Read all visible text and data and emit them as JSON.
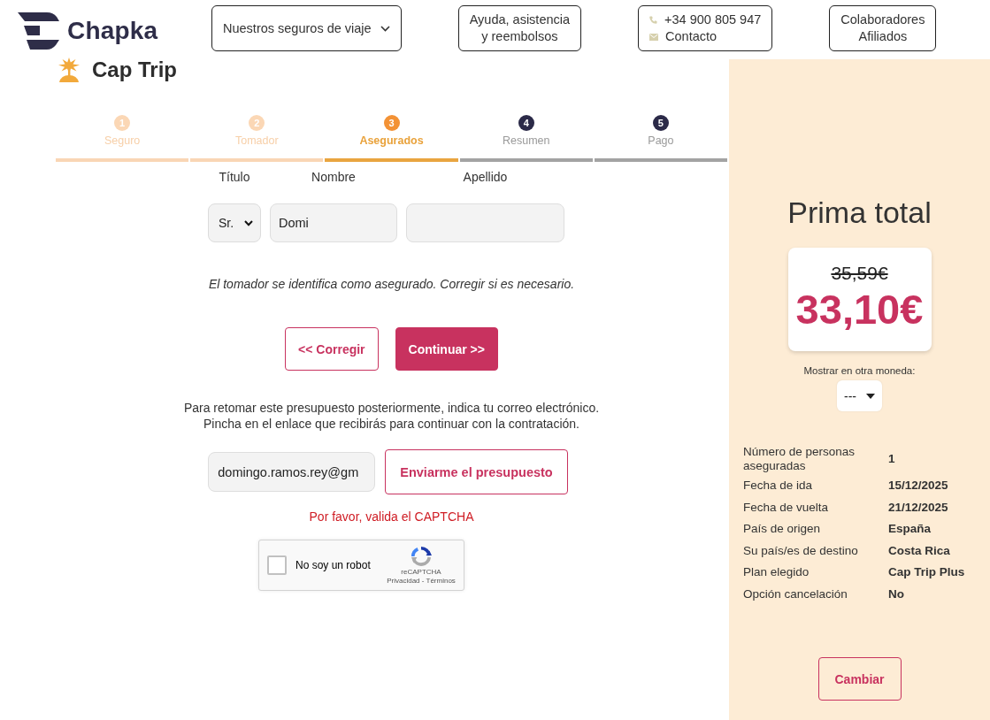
{
  "header": {
    "brand": "Chapka",
    "product": "Cap Trip",
    "nav": [
      {
        "kind": "dropdown",
        "lines": [
          "Nuestros seguros de viaje"
        ]
      },
      {
        "kind": "link",
        "lines": [
          "Ayuda, asistencia",
          "y reembolsos"
        ]
      },
      {
        "kind": "contact",
        "phone": "+34 900 805 947",
        "contact": "Contacto"
      },
      {
        "kind": "link",
        "lines": [
          "Colaboradores",
          "Afiliados"
        ]
      }
    ]
  },
  "steps": [
    {
      "number": "1",
      "label": "Seguro",
      "completed": true,
      "selected": false
    },
    {
      "number": "2",
      "label": "Tomador",
      "completed": true,
      "selected": false
    },
    {
      "number": "3",
      "label": "Asegurados",
      "completed": false,
      "selected": true
    },
    {
      "number": "4",
      "label": "Resumen",
      "completed": false,
      "selected": false
    },
    {
      "number": "5",
      "label": "Pago",
      "completed": false,
      "selected": false
    }
  ],
  "insured": {
    "fields": [
      {
        "kind": "select",
        "label": "Título",
        "value": "Sr."
      },
      {
        "kind": "text",
        "label": "Nombre",
        "value": "Domi"
      },
      {
        "kind": "text",
        "label": "Apellido"
      }
    ],
    "note": "El tomador se identifica como asegurado. Corregir si es necesario.",
    "buttons": [
      {
        "kind": "secondary",
        "label": "<< Corregir"
      },
      {
        "kind": "primary",
        "label": "Continuar >>"
      }
    ]
  },
  "save_quote": {
    "text": [
      "Para retomar este presupuesto posteriormente, indica tu correo electrónico.",
      "Pincha en el enlace que recibirás para continuar con la contratación."
    ],
    "email": {
      "value": "domingo.ramos.rey@gm"
    },
    "button": "Enviarme el presupuesto",
    "error": "Por favor, valida el CAPTCHA"
  },
  "captcha": {
    "label": "No soy un robot",
    "checked": false,
    "brand": "reCAPTCHA",
    "links": "Privacidad - Términos"
  },
  "summary": {
    "title": "Prima total",
    "old_price": "35,59€",
    "price": "33,10€",
    "currency": {
      "label": "Mostrar en otra moneda:",
      "value": "---"
    },
    "details": [
      {
        "label": "Número de personas aseguradas",
        "value": "1"
      },
      {
        "label": "Fecha de ida",
        "value": "15/12/2025"
      },
      {
        "label": "Fecha de vuelta",
        "value": "21/12/2025"
      },
      {
        "label": "País de origen",
        "value": "España"
      },
      {
        "label": "Su país/es de destino",
        "value": "Costa Rica"
      },
      {
        "label": "Plan elegido",
        "value": "Cap Trip Plus"
      },
      {
        "label": "Opción cancelación",
        "value": "No"
      }
    ],
    "button": "Cambiar"
  }
}
